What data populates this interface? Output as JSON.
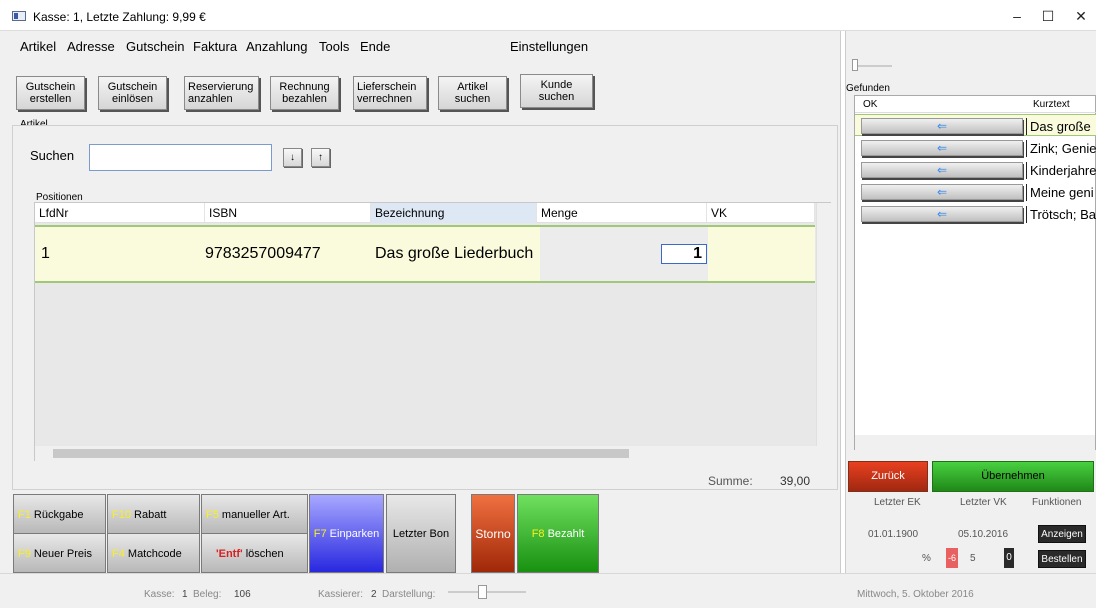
{
  "window": {
    "title": "Kasse: 1, Letzte Zahlung: 9,99 €",
    "minimize": "–",
    "maximize": "☐",
    "close": "✕"
  },
  "menu": {
    "items": [
      "Artikel",
      "Adresse",
      "Gutschein",
      "Faktura",
      "Anzahlung",
      "Tools",
      "Ende"
    ],
    "settings": "Einstellungen"
  },
  "toolbar": {
    "buttons": [
      {
        "line1": "Gutschein",
        "line2": "erstellen"
      },
      {
        "line1": "Gutschein",
        "line2": "einlösen"
      },
      {
        "line1": "Reservierung",
        "line2": "anzahlen"
      },
      {
        "line1": "Rechnung",
        "line2": "bezahlen"
      },
      {
        "line1": "Lieferschein",
        "line2": "verrechnen"
      },
      {
        "line1": "Artikel",
        "line2": "suchen"
      },
      {
        "line1": "Kunde",
        "line2": "suchen"
      }
    ]
  },
  "artikel": {
    "group_label": "Artikel",
    "search_label": "Suchen",
    "search_value": "",
    "down_arrow": "↓",
    "up_arrow": "↑"
  },
  "positionen": {
    "label": "Positionen",
    "columns": [
      "LfdNr",
      "ISBN",
      "Bezeichnung",
      "Menge",
      "VK"
    ],
    "rows": [
      {
        "lfdnr": "1",
        "isbn": "9783257009477",
        "bezeichnung": "Das große Liederbuch",
        "menge": "1",
        "vk": ""
      }
    ]
  },
  "summe": {
    "label": "Summe:",
    "value": "39,00"
  },
  "fkeys": {
    "f1": {
      "key": "F1",
      "label": "Rückgabe"
    },
    "f10": {
      "key": "F10",
      "label": "Rabatt"
    },
    "f5": {
      "key": "F5",
      "label": "manueller Art."
    },
    "f9": {
      "key": "F9",
      "label": "Neuer Preis"
    },
    "f4": {
      "key": "F4",
      "label": "Matchcode"
    },
    "entf": {
      "key": "'Entf'",
      "label": "löschen"
    },
    "f7": {
      "key": "F7",
      "label": "Einparken"
    },
    "letzter_bon": "Letzter Bon",
    "storno": "Storno",
    "f8": {
      "key": "F8",
      "label": "Bezahlt"
    }
  },
  "status": {
    "kasse_label": "Kasse:",
    "kasse_value": "1",
    "beleg_label": "Beleg:",
    "beleg_value": "106",
    "kassierer_label": "Kassierer:",
    "kassierer_value": "2",
    "darstellung_label": "Darstellung:",
    "date": "Mittwoch, 5. Oktober 2016"
  },
  "right": {
    "gefunden": "Gefunden",
    "columns": [
      "OK",
      "Kurztext"
    ],
    "ok_icon": "⇐",
    "results": [
      "Das große",
      "Zink; Genie",
      "Kinderjahre",
      "Meine geni",
      "Trötsch; Ba"
    ],
    "zurueck": "Zurück",
    "uebernehmen": "Übernehmen",
    "letzter_ek_label": "Letzter EK",
    "letzter_vk_label": "Letzter VK",
    "funktionen_label": "Funktionen",
    "letzter_ek": "01.01.1900",
    "letzter_vk": "05.10.2016",
    "anzeigen": "Anzeigen",
    "bestellen": "Bestellen",
    "percent": "%",
    "red_val": "-6",
    "mid_val": "5",
    "black_val": "0"
  },
  "colors": {
    "accent_green": "#48d040",
    "accent_red": "#e84020",
    "f7_blue": "#4040e8",
    "storno_orange": "#d04810"
  }
}
